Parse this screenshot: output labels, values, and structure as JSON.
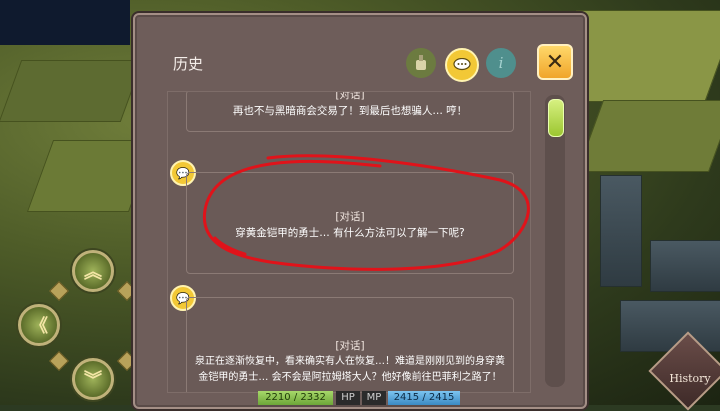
{
  "panel": {
    "title": "历史"
  },
  "tabs": [
    {
      "icon": "bag-icon"
    },
    {
      "icon": "chat-icon"
    },
    {
      "icon": "info-icon",
      "glyph": "i"
    }
  ],
  "close": {
    "glyph": "✕"
  },
  "entries": [
    {
      "tag": "[对话]",
      "text": "再也不与黑暗商会交易了！到最后也想骗人… 哼！"
    },
    {
      "tag": "[对话]",
      "text": "穿黄金铠甲的勇士… 有什么方法可以了解一下呢?"
    },
    {
      "tag": "[对话]",
      "line1": "泉正在逐渐恢复中，看来确实有人在恢复…！难道是刚刚见到的身穿黄",
      "line2": "金铠甲的勇士… 会不会是阿拉姆塔大人？他好像前往巴菲利之路了！"
    }
  ],
  "status": {
    "hp_value": "2210 / 2332",
    "hp_label": "HP",
    "mp_label": "MP",
    "mp_value": "2415 / 2415"
  },
  "history_button": "History",
  "colors": {
    "panel": "#6e5d5a",
    "accent_yellow": "#f2c836",
    "scroll_thumb": "#b7dc4e",
    "annotation_red": "#e0131a"
  }
}
